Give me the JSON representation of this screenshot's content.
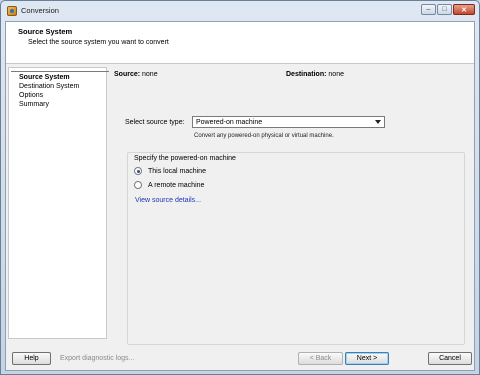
{
  "window": {
    "title": "Conversion"
  },
  "header": {
    "title": "Source System",
    "subtitle": "Select the source system you want to convert"
  },
  "nav": {
    "items": [
      {
        "label": "Source System",
        "active": true
      },
      {
        "label": "Destination System",
        "active": false
      },
      {
        "label": "Options",
        "active": false
      },
      {
        "label": "Summary",
        "active": false
      }
    ]
  },
  "summary": {
    "source_label": "Source:",
    "source_value": "none",
    "destination_label": "Destination:",
    "destination_value": "none"
  },
  "source_type": {
    "label": "Select source type:",
    "selected": "Powered-on machine",
    "help": "Convert any powered-on physical or virtual machine."
  },
  "machine_group": {
    "title": "Specify the powered-on machine",
    "options": [
      {
        "label": "This local machine",
        "selected": true
      },
      {
        "label": "A remote machine",
        "selected": false
      }
    ],
    "link": "View source details..."
  },
  "footer": {
    "help": "Help",
    "export": "Export diagnostic logs...",
    "back": "< Back",
    "next": "Next >",
    "cancel": "Cancel"
  },
  "icons": {
    "app": "converter-app-icon",
    "minimize": "minimize-icon",
    "maximize": "maximize-icon",
    "close": "close-icon",
    "dropdown": "chevron-down-icon"
  }
}
